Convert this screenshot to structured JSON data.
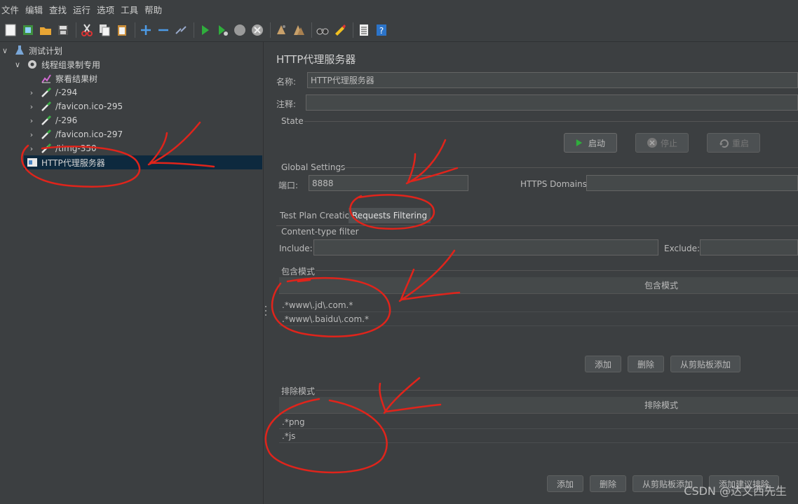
{
  "menu": [
    "文件",
    "编辑",
    "查找",
    "运行",
    "选项",
    "工具",
    "帮助"
  ],
  "toolbar_icons": [
    "new-icon",
    "templates-icon",
    "open-icon",
    "save-icon",
    "cut-icon",
    "copy-icon",
    "paste-icon",
    "expand-icon",
    "collapse-icon",
    "toggle-icon",
    "start-icon",
    "start-no-pause-icon",
    "stop-icon",
    "shutdown-icon",
    "clear-icon",
    "clear-all-icon",
    "search-icon",
    "reset-search-icon",
    "function-helper-icon",
    "help-icon"
  ],
  "tree": {
    "items": [
      {
        "label": "测试计划",
        "icon": "flask-icon",
        "expand": "∨"
      },
      {
        "label": "线程组录制专用",
        "icon": "gear-icon",
        "expand": "∨"
      },
      {
        "label": "察看结果树",
        "icon": "chart-icon",
        "expand": ""
      },
      {
        "label": "/-294",
        "icon": "pipette-icon",
        "expand": "›"
      },
      {
        "label": "/favicon.ico-295",
        "icon": "pipette-icon",
        "expand": "›"
      },
      {
        "label": "/-296",
        "icon": "pipette-icon",
        "expand": "›"
      },
      {
        "label": "/favicon.ico-297",
        "icon": "pipette-icon",
        "expand": "›"
      },
      {
        "label": "/timg-350",
        "icon": "pipette-icon",
        "expand": "›"
      },
      {
        "label": "HTTP代理服务器",
        "icon": "proxy-icon",
        "expand": ""
      }
    ]
  },
  "panel": {
    "title": "HTTP代理服务器",
    "name_label": "名称:",
    "name_value": "HTTP代理服务器",
    "comment_label": "注释:",
    "comment_value": "",
    "state_title": "State",
    "start_label": "启动",
    "stop_label": "停止",
    "restart_label": "重启",
    "global_title": "Global Settings",
    "port_label": "端口:",
    "port_value": "8888",
    "https_label": "HTTPS Domains:",
    "https_value": "",
    "tabs": [
      "Test Plan Creation",
      "Requests Filtering"
    ],
    "content_type_title": "Content-type filter",
    "include_label": "Include:",
    "include_value": "",
    "exclude_label": "Exclude:",
    "exclude_value": "",
    "include_pattern_title": "包含模式",
    "include_pattern_header": "包含模式",
    "include_patterns": [
      ".*www\\.jd\\.com.*",
      ".*www\\.baidu\\.com.*"
    ],
    "include_buttons": [
      "添加",
      "删除",
      "从剪贴板添加"
    ],
    "exclude_pattern_title": "排除模式",
    "exclude_pattern_header": "排除模式",
    "exclude_patterns": [
      ".*png",
      ".*js"
    ],
    "exclude_buttons": [
      "添加",
      "删除",
      "从剪贴板添加",
      "添加建议排除"
    ]
  },
  "watermark": "CSDN @达文西先生",
  "colors": {
    "background": "#3c3f41",
    "selected": "#0d293e",
    "annotation": "#e0241b",
    "play": "#2fae3c"
  }
}
